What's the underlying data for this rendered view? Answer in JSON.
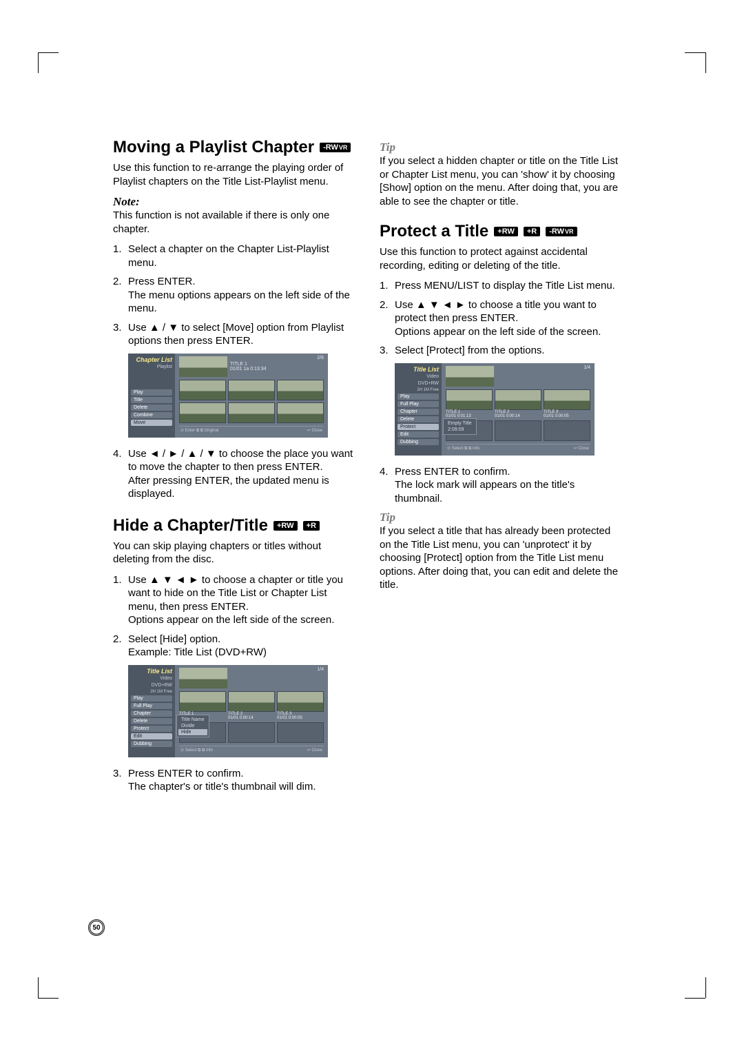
{
  "page_number": "50",
  "left": {
    "section1": {
      "title": "Moving a Playlist Chapter",
      "badge1": "-RW",
      "badge1_sub": "VR",
      "intro": "Use this function to re-arrange the playing order of Playlist chapters on the Title List-Playlist menu.",
      "note_label": "Note:",
      "note_text": "This function is not available if there is only one chapter.",
      "step1": "Select a chapter on the Chapter List-Playlist menu.",
      "step2a": "Press ENTER.",
      "step2b": "The menu options appears on the left side of the menu.",
      "step3": "Use ▲ / ▼ to select [Move] option from Playlist options then press ENTER.",
      "step4a": "Use ◄ / ► / ▲ / ▼ to choose the place you want to move the chapter to then press ENTER.",
      "step4b": "After pressing ENTER, the updated menu is displayed.",
      "mock": {
        "side_header": "Chapter List",
        "side_sub": "Playlist",
        "menu": [
          "Play",
          "Title",
          "Delete",
          "Combine",
          "Move"
        ],
        "preview_title": "TITLE 1",
        "preview_sub": "01/01 1a 0:13:34",
        "counter": "2/6",
        "foot_left": "⊙ Enter  ⧉ ⧉ Original",
        "foot_right": "↩ Close"
      }
    },
    "section2": {
      "title": "Hide a Chapter/Title",
      "badge1": "+RW",
      "badge2": "+R",
      "intro": "You can skip playing chapters or titles without deleting from the disc.",
      "step1a": "Use ▲ ▼ ◄ ► to choose a chapter or title you want to hide on the Title List or Chapter List menu, then press ENTER.",
      "step1b": "Options appear on the left side of the screen.",
      "step2a": "Select [Hide] option.",
      "step2b": "Example: Title List (DVD+RW)",
      "step3a": "Press ENTER to confirm.",
      "step3b": "The chapter's or title's thumbnail will dim.",
      "mock": {
        "side_header": "Title List",
        "side_sub": "Video",
        "side_sub2": "DVD+RW",
        "meta": "2H 1M\nFree",
        "menu": [
          "Play",
          "Full Play",
          "Chapter",
          "Delete",
          "Protect",
          "Edit",
          "Dubbing"
        ],
        "t1": "TITLE 1",
        "t1b": "01/01    0:01:13",
        "t2": "TITLE 2",
        "t2b": "01/01    0:00:14",
        "t3": "TITLE 3",
        "t3b": "01/01    0:00:05",
        "counter": "1/4",
        "popup": [
          "Title Name",
          "Divide",
          "Hide"
        ],
        "foot_left": "⊙ Select  ⧉ ⧉ Info",
        "foot_right": "↩ Close"
      }
    }
  },
  "right": {
    "tip1_label": "Tip",
    "tip1_text": "If you select a hidden chapter or title on the Title List or Chapter List menu, you can 'show' it by choosing [Show] option on the menu. After doing that, you are able to see the chapter or title.",
    "section3": {
      "title": "Protect a Title",
      "badge1": "+RW",
      "badge2": "+R",
      "badge3": "-RW",
      "badge3_sub": "VR",
      "intro": "Use this function to protect against accidental recording, editing or deleting of the title.",
      "step1": "Press MENU/LIST to display the Title List menu.",
      "step2a": "Use ▲ ▼ ◄ ► to choose a title you want to protect then press ENTER.",
      "step2b": "Options appear on the left side of the screen.",
      "step3": "Select [Protect] from the options.",
      "step4a": "Press ENTER to confirm.",
      "step4b": "The lock mark will appears on the title's thumbnail.",
      "mock": {
        "side_header": "Title List",
        "side_sub": "Video",
        "side_sub2": "DVD+RW",
        "meta": "2H 1M\nFree",
        "menu": [
          "Play",
          "Full Play",
          "Chapter",
          "Delete",
          "Protect",
          "Edit",
          "Dubbing"
        ],
        "t1": "TITLE 1",
        "t1b": "01/01    0:01:13",
        "t2": "TITLE 2",
        "t2b": "01/01    0:00:14",
        "t3": "TITLE 3",
        "t3b": "01/01    0:00:05",
        "counter": "1/4",
        "popup": [
          "Empty Title",
          "2:09:09"
        ],
        "foot_left": "⊙ Select  ⧉ ⧉ Info",
        "foot_right": "↩ Close"
      }
    },
    "tip2_label": "Tip",
    "tip2_text": "If you select a title that has already been protected on the Title List menu, you can 'unprotect' it by choosing [Protect] option from the Title List menu options. After doing that, you can edit and delete the title."
  }
}
